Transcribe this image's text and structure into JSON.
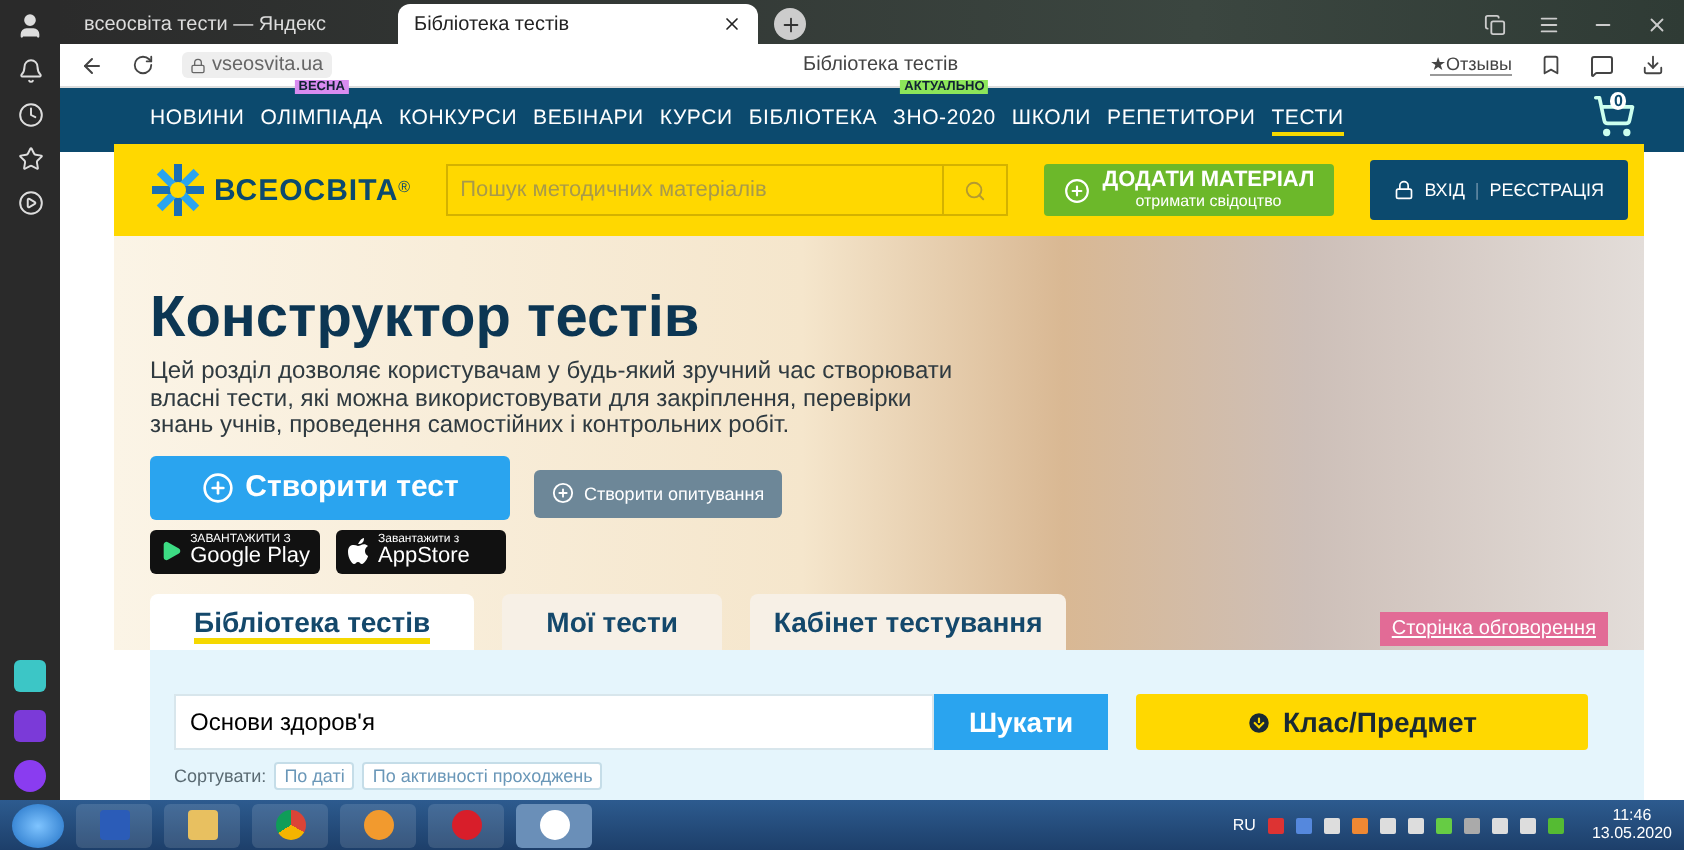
{
  "browser": {
    "tabs": [
      {
        "label": "всеосвіта тести — Яндекс",
        "selected": false
      },
      {
        "label": "Бібліотека тестів",
        "selected": true
      }
    ],
    "address": "vseosvita.ua",
    "page_title": "Бібліотека тестів",
    "reviews": "★Отзывы"
  },
  "nav": {
    "items": [
      {
        "label": "НОВИНИ",
        "selected": false
      },
      {
        "label": "ОЛІМПІАДА",
        "selected": false,
        "badge": {
          "text": "ВЕСНА",
          "color": "#d98cf0"
        }
      },
      {
        "label": "КОНКУРСИ",
        "selected": false
      },
      {
        "label": "ВЕБІНАРИ",
        "selected": false
      },
      {
        "label": "КУРСИ",
        "selected": false
      },
      {
        "label": "БІБЛІОТЕКА",
        "selected": false
      },
      {
        "label": "ЗНО-2020",
        "selected": false,
        "badge": {
          "text": "АКТУАЛЬНО",
          "color": "#8ce65a"
        }
      },
      {
        "label": "ШКОЛИ",
        "selected": false
      },
      {
        "label": "РЕПЕТИТОРИ",
        "selected": false
      },
      {
        "label": "ТЕСТИ",
        "selected": true
      }
    ],
    "cart_count": "0"
  },
  "header": {
    "logo": "ВСЕОСВІТА",
    "logo_mark": "®",
    "auth_separator": "|",
    "search_placeholder": "Пошук методичних матеріалів",
    "add_button": {
      "title": "ДОДАТИ МАТЕРІАЛ",
      "subtitle": "отримати свідоцтво"
    },
    "login": "ВХІД",
    "register": "РЕЄСТРАЦІЯ"
  },
  "hero": {
    "title": "Конструктор тестів",
    "description": "Цей розділ дозволяє користувачам у будь-який зручний час створювати власні тести, які можна використовувати для закріплення, перевірки знань учнів, проведення самостійних і контрольних робіт.",
    "create_test": "Створити тест",
    "create_poll": "Створити опитування",
    "stores": [
      {
        "kind": "google",
        "small": "ЗАВАНТАЖИТИ З",
        "big": "Google Play"
      },
      {
        "kind": "apple",
        "small": "Завантажити з",
        "big": "AppStore"
      }
    ]
  },
  "tabs": [
    {
      "label": "Бібліотека тестів",
      "selected": true
    },
    {
      "label": "Мої тести",
      "selected": false
    },
    {
      "label": "Кабінет тестування",
      "selected": false
    }
  ],
  "discussion_link": "Сторінка обговорення",
  "search": {
    "value": "Основи здоров'я",
    "button": "Шукати",
    "class_button": "Клас/Предмет",
    "sort_label": "Сортувати:",
    "sort_options": [
      "По даті",
      "По активності проходжень"
    ]
  },
  "taskbar": {
    "language": "RU",
    "time": "11:46",
    "date": "13.05.2020"
  }
}
